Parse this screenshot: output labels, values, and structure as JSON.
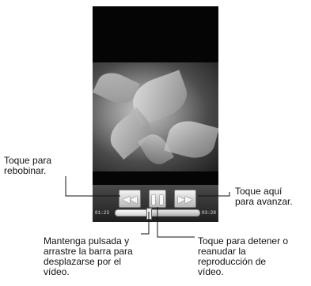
{
  "player": {
    "rewind_icon": "rewind-icon",
    "pause_icon": "pause-icon",
    "forward_icon": "fast-forward-icon",
    "elapsed": "01:23",
    "duration": "03:28",
    "progress_fraction": 0.4
  },
  "callouts": {
    "rewind": "Toque para\nrebobinar.",
    "forward": "Toque aquí\npara avanzar.",
    "seek": "Mantenga pulsada y\narrastre la barra para\ndesplazarse por el\nvídeo.",
    "pause": "Toque para detener o\nreanudar la\nreproducción de\nvídeo."
  }
}
